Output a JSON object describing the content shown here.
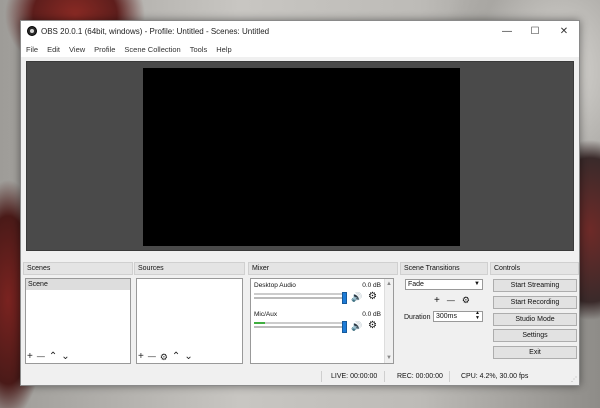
{
  "window": {
    "title": "OBS 20.0.1 (64bit, windows) - Profile: Untitled - Scenes: Untitled",
    "minimize": "—",
    "maximize": "☐",
    "close": "✕"
  },
  "menu": [
    "File",
    "Edit",
    "View",
    "Profile",
    "Scene Collection",
    "Tools",
    "Help"
  ],
  "scenes": {
    "header": "Scenes",
    "items": [
      "Scene"
    ],
    "add": "+",
    "remove": "—",
    "up": "⌃",
    "down": "⌄"
  },
  "sources": {
    "header": "Sources",
    "add": "+",
    "remove": "—",
    "settings": "⚙",
    "up": "⌃",
    "down": "⌄"
  },
  "mixer": {
    "header": "Mixer",
    "channels": [
      {
        "name": "Desktop Audio",
        "db": "0.0 dB",
        "level": 0
      },
      {
        "name": "Mic/Aux",
        "db": "0.0 dB",
        "level": 0.12
      }
    ],
    "volume_icon": "🔊",
    "gear_icon": "⚙",
    "scroll_up": "▲",
    "scroll_down": "▼"
  },
  "transitions": {
    "header": "Scene Transitions",
    "selected": "Fade",
    "add": "+",
    "remove": "—",
    "settings": "⚙",
    "duration_label": "Duration",
    "duration_value": "300ms"
  },
  "controls": {
    "header": "Controls",
    "buttons": [
      "Start Streaming",
      "Start Recording",
      "Studio Mode",
      "Settings",
      "Exit"
    ]
  },
  "status": {
    "live": "LIVE: 00:00:00",
    "rec": "REC: 00:00:00",
    "cpu": "CPU: 4.2%, 30.00 fps"
  },
  "colors": {
    "preview_bg": "#4a4a4a",
    "canvas": "#000000",
    "slider": "#1e7bd6",
    "meter": "#3fae3f"
  }
}
